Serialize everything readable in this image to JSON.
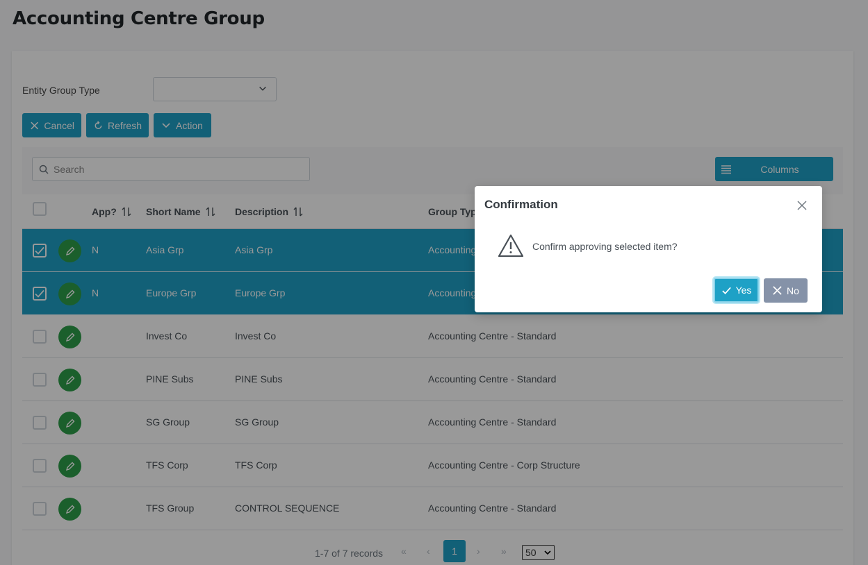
{
  "page": {
    "title": "Accounting Centre Group"
  },
  "filter": {
    "label": "Entity Group Type",
    "value": ""
  },
  "toolbar": {
    "cancel_label": "Cancel",
    "refresh_label": "Refresh",
    "action_label": "Action"
  },
  "table": {
    "search_placeholder": "Search",
    "columns_label": "Columns",
    "headers": {
      "app": "App?",
      "short_name": "Short Name",
      "description": "Description",
      "group_type": "Group Typ"
    },
    "rows": [
      {
        "selected": true,
        "app": "N",
        "short_name": "Asia Grp",
        "description": "Asia Grp",
        "group_type": "Accounting"
      },
      {
        "selected": true,
        "app": "N",
        "short_name": "Europe Grp",
        "description": "Europe Grp",
        "group_type": "Accounting"
      },
      {
        "selected": false,
        "app": "",
        "short_name": "Invest Co",
        "description": "Invest Co",
        "group_type": "Accounting Centre - Standard"
      },
      {
        "selected": false,
        "app": "",
        "short_name": "PINE Subs",
        "description": "PINE Subs",
        "group_type": "Accounting Centre - Standard"
      },
      {
        "selected": false,
        "app": "",
        "short_name": "SG Group",
        "description": "SG Group",
        "group_type": "Accounting Centre - Standard"
      },
      {
        "selected": false,
        "app": "",
        "short_name": "TFS Corp",
        "description": "TFS Corp",
        "group_type": "Accounting Centre - Corp Structure"
      },
      {
        "selected": false,
        "app": "",
        "short_name": "TFS Group",
        "description": "CONTROL SEQUENCE",
        "group_type": "Accounting Centre - Standard"
      }
    ]
  },
  "pagination": {
    "info": "1-7 of 7 records",
    "first": "«",
    "prev": "‹",
    "current_page": "1",
    "next": "›",
    "last": "»",
    "page_size": "50"
  },
  "dialog": {
    "title": "Confirmation",
    "message": "Confirm approving selected item?",
    "yes_label": "Yes",
    "no_label": "No"
  },
  "colors": {
    "accent": "#1ea1c6",
    "edit": "#2e9e4a",
    "no_button": "#8592a8"
  }
}
